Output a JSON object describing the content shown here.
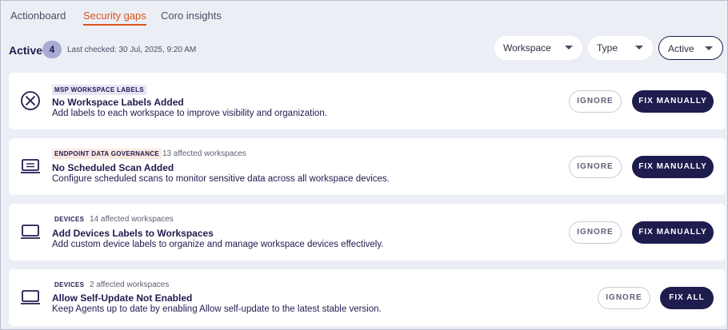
{
  "tabs": [
    {
      "label": "Actionboard"
    },
    {
      "label": "Security gaps",
      "active": true
    },
    {
      "label": "Coro insights"
    }
  ],
  "status": {
    "title": "Active",
    "count": "4",
    "last_checked": "Last checked: 30 Jul, 2025, 9:20 AM"
  },
  "filters": {
    "workspace": "Workspace",
    "type": "Type",
    "state": "Active"
  },
  "cards": [
    {
      "icon": "blocked-circle-icon",
      "category": "MSP WORKSPACE LABELS",
      "affected": "",
      "title": "No Workspace Labels Added",
      "description": "Add labels to each workspace to improve visibility and organization.",
      "ignore_label": "IGNORE",
      "fix_label": "FIX MANUALLY"
    },
    {
      "icon": "laptop-data-icon",
      "category": "ENDPOINT DATA GOVERNANCE",
      "affected": "13 affected workspaces",
      "title": "No Scheduled Scan Added",
      "description": "Configure scheduled scans to monitor sensitive data across all workspace devices.",
      "ignore_label": "IGNORE",
      "fix_label": "FIX MANUALLY"
    },
    {
      "icon": "laptop-icon",
      "category": "DEVICES",
      "affected": "14 affected workspaces",
      "title": "Add Devices Labels to Workspaces",
      "description": "Add custom device labels to organize and manage workspace devices effectively.",
      "ignore_label": "IGNORE",
      "fix_label": "FIX MANUALLY"
    },
    {
      "icon": "laptop-icon",
      "category": "DEVICES",
      "affected": "2 affected workspaces",
      "title": "Allow Self-Update Not Enabled",
      "description": "Keep Agents up to date by enabling Allow self-update to the latest stable version.",
      "ignore_label": "IGNORE",
      "fix_label": "FIX ALL"
    }
  ],
  "colors": {
    "accent": "#d9531e",
    "primary": "#1f1c4e",
    "background": "#eceef6"
  }
}
